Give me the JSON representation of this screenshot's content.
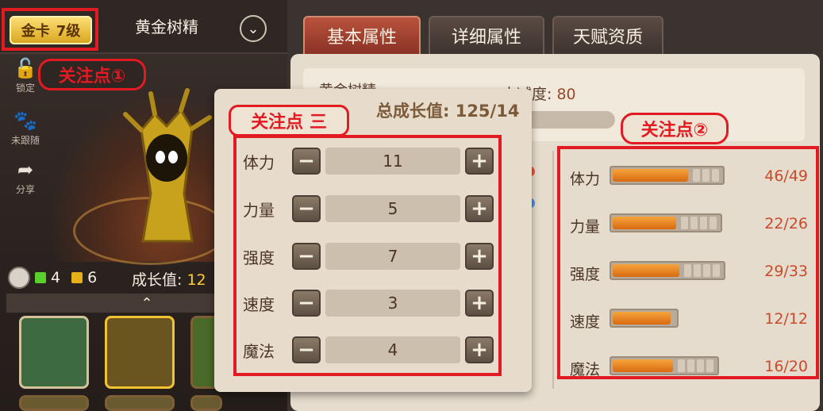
{
  "header": {
    "card_type": "金卡",
    "card_level": "7级",
    "pet_name": "黄金树精"
  },
  "sidebar": {
    "items": [
      {
        "label": "锁定",
        "icon": "lock-icon"
      },
      {
        "label": "未跟随",
        "icon": "paw-icon"
      },
      {
        "label": "分享",
        "icon": "share-icon"
      }
    ]
  },
  "annotations": {
    "focus_1": "关注点①",
    "focus_2": "关注点②",
    "focus_3": "关注点 三"
  },
  "pet_stats": {
    "green_count": "4",
    "gold_count": "6",
    "growth_label": "成长值:",
    "growth_value": "12"
  },
  "tabs": [
    {
      "label": "基本属性",
      "active": true
    },
    {
      "label": "详细属性",
      "active": false
    },
    {
      "label": "天赋资质",
      "active": false
    }
  ],
  "info": {
    "name": "黄金树精",
    "resist_label": "内减度:",
    "resist_value": "80"
  },
  "popup": {
    "total_growth": "总成长值: 125/14",
    "allocation": [
      {
        "label": "体力",
        "value": "11"
      },
      {
        "label": "力量",
        "value": "5"
      },
      {
        "label": "强度",
        "value": "7"
      },
      {
        "label": "速度",
        "value": "3"
      },
      {
        "label": "魔法",
        "value": "4"
      }
    ]
  },
  "attributes": [
    {
      "label": "体力",
      "value": "46/49",
      "current": 46,
      "max": 49
    },
    {
      "label": "力量",
      "value": "22/26",
      "current": 22,
      "max": 26
    },
    {
      "label": "强度",
      "value": "29/33",
      "current": 29,
      "max": 33
    },
    {
      "label": "速度",
      "value": "12/12",
      "current": 12,
      "max": 12
    },
    {
      "label": "魔法",
      "value": "16/20",
      "current": 16,
      "max": 20
    }
  ],
  "colors": {
    "highlight_red": "#e21a22",
    "gold_badge": "#f1c232",
    "bar_orange": "#e8841c",
    "active_tab": "#a8432f"
  }
}
